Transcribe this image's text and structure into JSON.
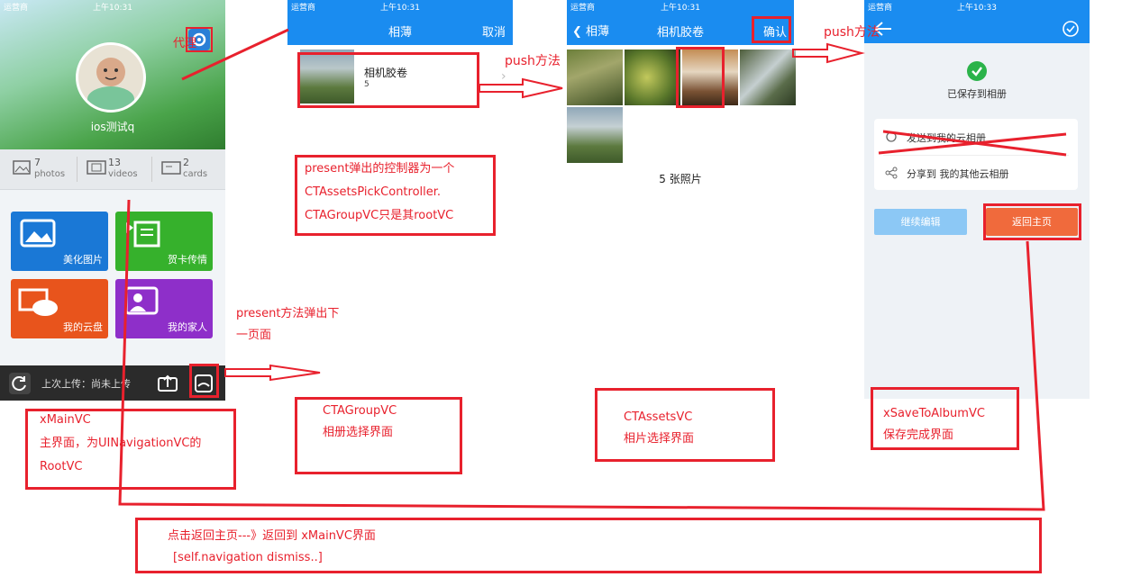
{
  "screen1": {
    "status_carrier": "运营商",
    "status_time": "上午10:31",
    "delegate_label": "代理",
    "username": "ios测试q",
    "stats": [
      {
        "num": "7",
        "label": "photos",
        "icon": "photo-icon"
      },
      {
        "num": "13",
        "label": "videos",
        "icon": "video-icon"
      },
      {
        "num": "2",
        "label": "cards",
        "icon": "card-icon"
      }
    ],
    "tiles": [
      {
        "label": "美化图片",
        "color": "#1a78d6",
        "icon": "image-icon"
      },
      {
        "label": "贺卡传情",
        "color": "#36b12c",
        "icon": "card-icon"
      },
      {
        "label": "我的云盘",
        "color": "#e8541c",
        "icon": "cloud-icon"
      },
      {
        "label": "我的家人",
        "color": "#8e2fc9",
        "icon": "family-icon"
      }
    ],
    "upload_text": "上次上传：尚未上传"
  },
  "screen2": {
    "status_carrier": "运营商",
    "status_time": "上午10:31",
    "title": "相薄",
    "cancel": "取消",
    "album_name": "相机胶卷",
    "album_count": "5"
  },
  "screen3": {
    "status_carrier": "运营商",
    "status_time": "上午10:31",
    "back": "相薄",
    "title": "相机胶卷",
    "confirm": "确认",
    "count_text": "5 张照片"
  },
  "screen4": {
    "status_carrier": "运营商",
    "status_time": "上午10:33",
    "saved_text": "已保存到相册",
    "share1": "发送到我的云相册",
    "share2": "分享到 我的其他云相册",
    "continue_btn": "继续编辑",
    "home_btn": "返回主页"
  },
  "annotations": {
    "push1": "push方法",
    "push2": "push方法",
    "present_line1": "present弹出的控制器为一个",
    "present_line2": "CTAssetsPickController.",
    "present_line3": "CTAGroupVC只是其rootVC",
    "present_method1": "present方法弹出下",
    "present_method2": "一页面",
    "main_title": "xMainVC",
    "main_desc1": "主界面，为UINavigationVC的",
    "main_desc2": "RootVC",
    "group_title": "CTAGroupVC",
    "group_desc": "相册选择界面",
    "assets_title": "CTAssetsVC",
    "assets_desc": "相片选择界面",
    "save_title": "xSaveToAlbumVC",
    "save_desc": "保存完成界面",
    "bottom_line1": "点击返回主页---》返回到 xMainVC界面",
    "bottom_line2": "[self.navigation dismiss..]"
  },
  "colors": {
    "annotation_red": "#e8212d",
    "nav_blue": "#1a8cf0",
    "home_button": "#f06a3c",
    "continue_button": "#8cc8f5",
    "success_green": "#2bb34a"
  }
}
